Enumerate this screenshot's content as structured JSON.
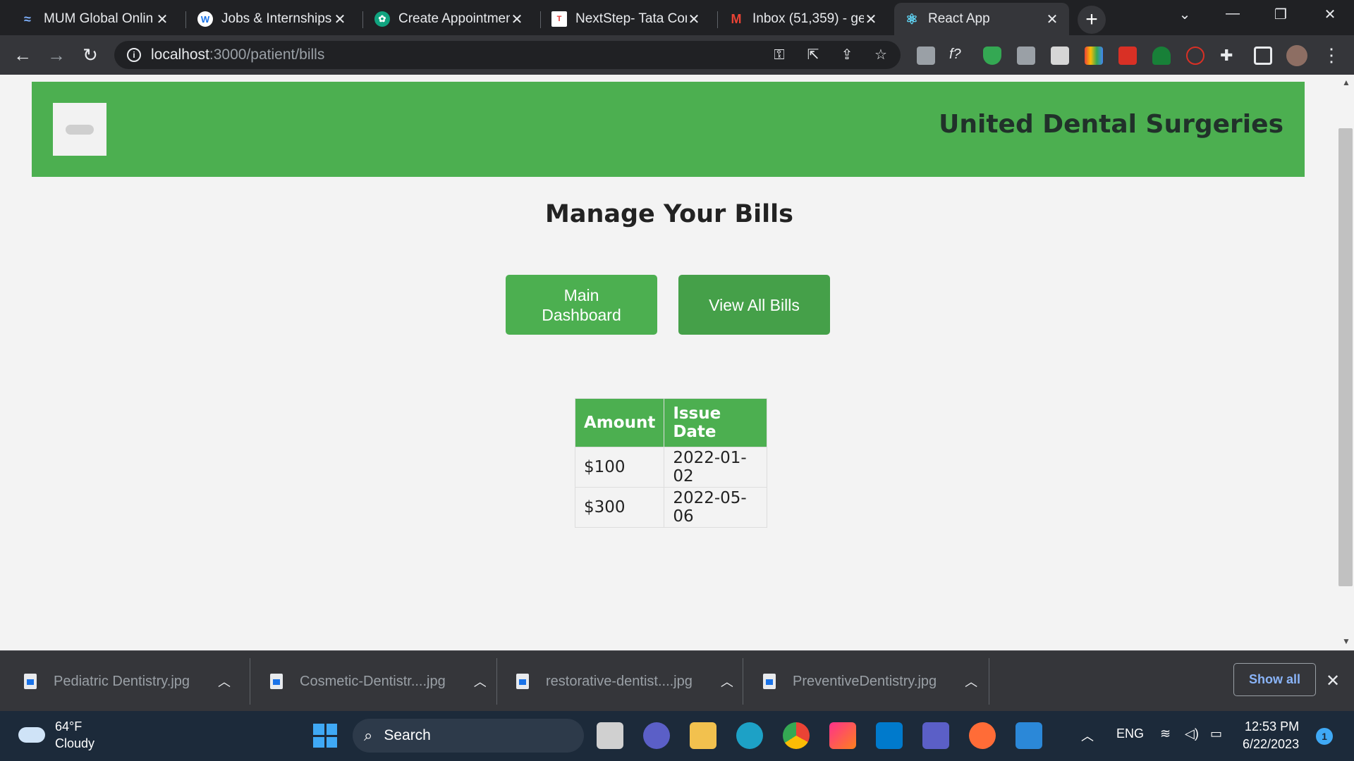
{
  "browser": {
    "tabs": [
      {
        "title": "MUM Global Onlin",
        "icon": "globe-icon",
        "color": "#7fb2ff",
        "glyph": "≈"
      },
      {
        "title": "Jobs & Internships",
        "icon": "w-icon",
        "color": "#1a73e8",
        "glyph": "W"
      },
      {
        "title": "Create Appointmen",
        "icon": "chatgpt-icon",
        "color": "#10a37f",
        "glyph": "✿"
      },
      {
        "title": "NextStep- Tata Con",
        "icon": "tcs-icon",
        "color": "#e53935",
        "glyph": "T"
      },
      {
        "title": "Inbox (51,359) - ge",
        "icon": "gmail-icon",
        "color": "#ea4335",
        "glyph": "M"
      },
      {
        "title": "React App",
        "icon": "react-icon",
        "color": "#61dafb",
        "glyph": "⚛"
      }
    ],
    "url_host": "localhost",
    "url_path": ":3000/patient/bills"
  },
  "page": {
    "site_title": "United Dental Surgeries",
    "heading": "Manage Your Bills",
    "buttons": {
      "main_dashboard": "Main Dashboard",
      "view_all_bills": "View All Bills"
    },
    "table": {
      "headers": [
        "Amount",
        "Issue Date"
      ],
      "rows": [
        [
          "$100",
          "2022-01-02"
        ],
        [
          "$300",
          "2022-05-06"
        ]
      ]
    },
    "colors": {
      "accent": "#4caf50"
    }
  },
  "downloads": {
    "items": [
      "Pediatric Dentistry.jpg",
      "Cosmetic-Dentistr....jpg",
      "restorative-dentist....jpg",
      "PreventiveDentistry.jpg"
    ],
    "show_all": "Show all"
  },
  "taskbar": {
    "temperature": "64°F",
    "weather": "Cloudy",
    "search": "Search",
    "language": "ENG",
    "time": "12:53 PM",
    "date": "6/22/2023",
    "notifications": "1"
  }
}
